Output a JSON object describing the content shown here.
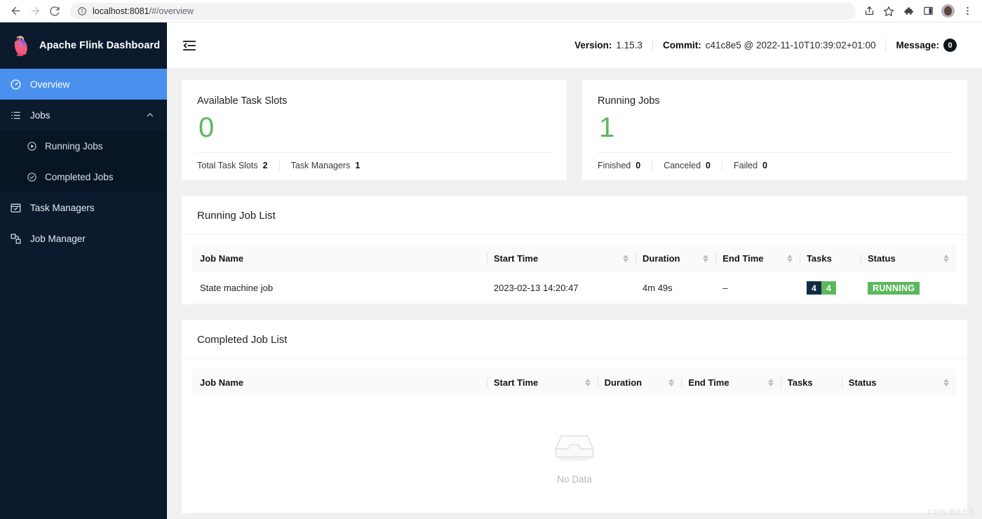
{
  "browser": {
    "url_host": "localhost:8081",
    "url_path": "/#/overview",
    "back_icon": "back-arrow-icon",
    "forward_icon": "forward-arrow-icon",
    "reload_icon": "reload-icon",
    "info_icon": "site-info-icon",
    "share_icon": "share-icon",
    "bookmark_icon": "star-icon",
    "extensions_icon": "puzzle-icon",
    "sidepanel_icon": "side-panel-icon",
    "profile_icon": "avatar-icon",
    "menu_icon": "three-dot-menu-icon"
  },
  "sidebar": {
    "brand": "Apache Flink Dashboard",
    "items": [
      {
        "label": "Overview",
        "icon": "dashboard-icon",
        "active": true
      },
      {
        "label": "Jobs",
        "icon": "list-icon",
        "active": false,
        "expanded": true
      },
      {
        "label": "Task Managers",
        "icon": "task-managers-icon",
        "active": false
      },
      {
        "label": "Job Manager",
        "icon": "job-manager-icon",
        "active": false
      }
    ],
    "sub_items": [
      {
        "label": "Running Jobs",
        "icon": "play-circle-icon"
      },
      {
        "label": "Completed Jobs",
        "icon": "check-circle-icon"
      }
    ]
  },
  "topbar": {
    "fold_icon": "menu-fold-icon",
    "version_key": "Version:",
    "version_value": "1.15.3",
    "commit_key": "Commit:",
    "commit_value": "c41c8e5 @ 2022-11-10T10:39:02+01:00",
    "message_key": "Message:",
    "message_count": "0"
  },
  "cards": [
    {
      "title": "Available Task Slots",
      "value": "0",
      "footer": [
        {
          "key": "Total Task Slots",
          "value": "2"
        },
        {
          "key": "Task Managers",
          "value": "1"
        }
      ]
    },
    {
      "title": "Running Jobs",
      "value": "1",
      "footer": [
        {
          "key": "Finished",
          "value": "0"
        },
        {
          "key": "Canceled",
          "value": "0"
        },
        {
          "key": "Failed",
          "value": "0"
        }
      ]
    }
  ],
  "running_panel": {
    "title": "Running Job List",
    "columns": [
      {
        "label": "Job Name",
        "sortable": false
      },
      {
        "label": "Start Time",
        "sortable": true
      },
      {
        "label": "Duration",
        "sortable": true
      },
      {
        "label": "End Time",
        "sortable": true
      },
      {
        "label": "Tasks",
        "sortable": false
      },
      {
        "label": "Status",
        "sortable": true
      }
    ],
    "rows": [
      {
        "job_name": "State machine job",
        "start_time": "2023-02-13 14:20:47",
        "duration": "4m 49s",
        "end_time": "–",
        "tasks_total": "4",
        "tasks_running": "4",
        "status": "RUNNING"
      }
    ]
  },
  "completed_panel": {
    "title": "Completed Job List",
    "columns": [
      {
        "label": "Job Name",
        "sortable": false
      },
      {
        "label": "Start Time",
        "sortable": true
      },
      {
        "label": "Duration",
        "sortable": true
      },
      {
        "label": "End Time",
        "sortable": true
      },
      {
        "label": "Tasks",
        "sortable": false
      },
      {
        "label": "Status",
        "sortable": true
      }
    ],
    "empty_text": "No Data",
    "empty_icon": "empty-inbox-icon"
  },
  "watermark": "CSDN @站长在",
  "colors": {
    "sidebar_bg": "#0b1a2d",
    "sidebar_sub_bg": "#081525",
    "active_nav": "#4a90ef",
    "page_bg": "#f0f0f0",
    "accent_green": "#5cb85c",
    "task_dark": "#112b44",
    "badge_dark": "#10161d"
  }
}
